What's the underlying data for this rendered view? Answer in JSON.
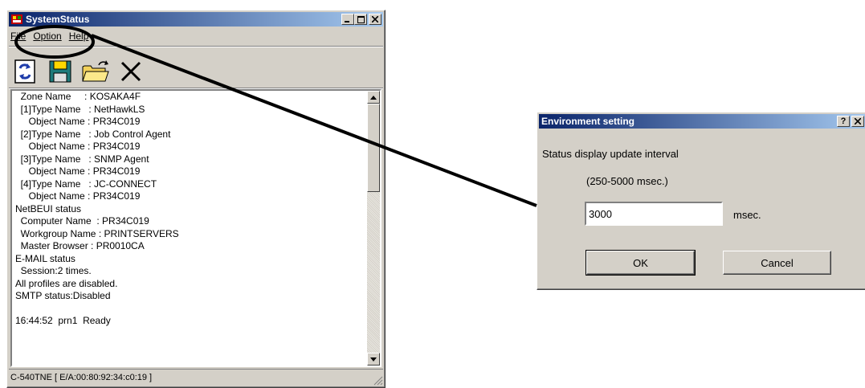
{
  "main_window": {
    "title": "SystemStatus",
    "menu": {
      "file": "File",
      "option": "Option",
      "help": "Help"
    },
    "toolbar_icons": [
      "refresh-icon",
      "save-icon",
      "open-folder-icon",
      "clear-icon"
    ],
    "lines": [
      "  Zone Name     : KOSAKA4F",
      "  [1]Type Name   : NetHawkLS",
      "     Object Name : PR34C019",
      "  [2]Type Name   : Job Control Agent",
      "     Object Name : PR34C019",
      "  [3]Type Name   : SNMP Agent",
      "     Object Name : PR34C019",
      "  [4]Type Name   : JC-CONNECT",
      "     Object Name : PR34C019",
      "NetBEUI status",
      "  Computer Name  : PR34C019",
      "  Workgroup Name : PRINTSERVERS",
      "  Master Browser : PR0010CA",
      "E-MAIL status",
      "  Session:2 times.",
      "All profiles are disabled.",
      "SMTP status:Disabled",
      "",
      "16:44:52  prn1  Ready"
    ],
    "status_bar": "C-540TNE [ E/A:00:80:92:34:c0:19 ]"
  },
  "dialog": {
    "title": "Environment setting",
    "label": "Status display update interval",
    "range": "(250-5000 msec.)",
    "value": "3000",
    "unit": "msec.",
    "ok": "OK",
    "cancel": "Cancel"
  }
}
